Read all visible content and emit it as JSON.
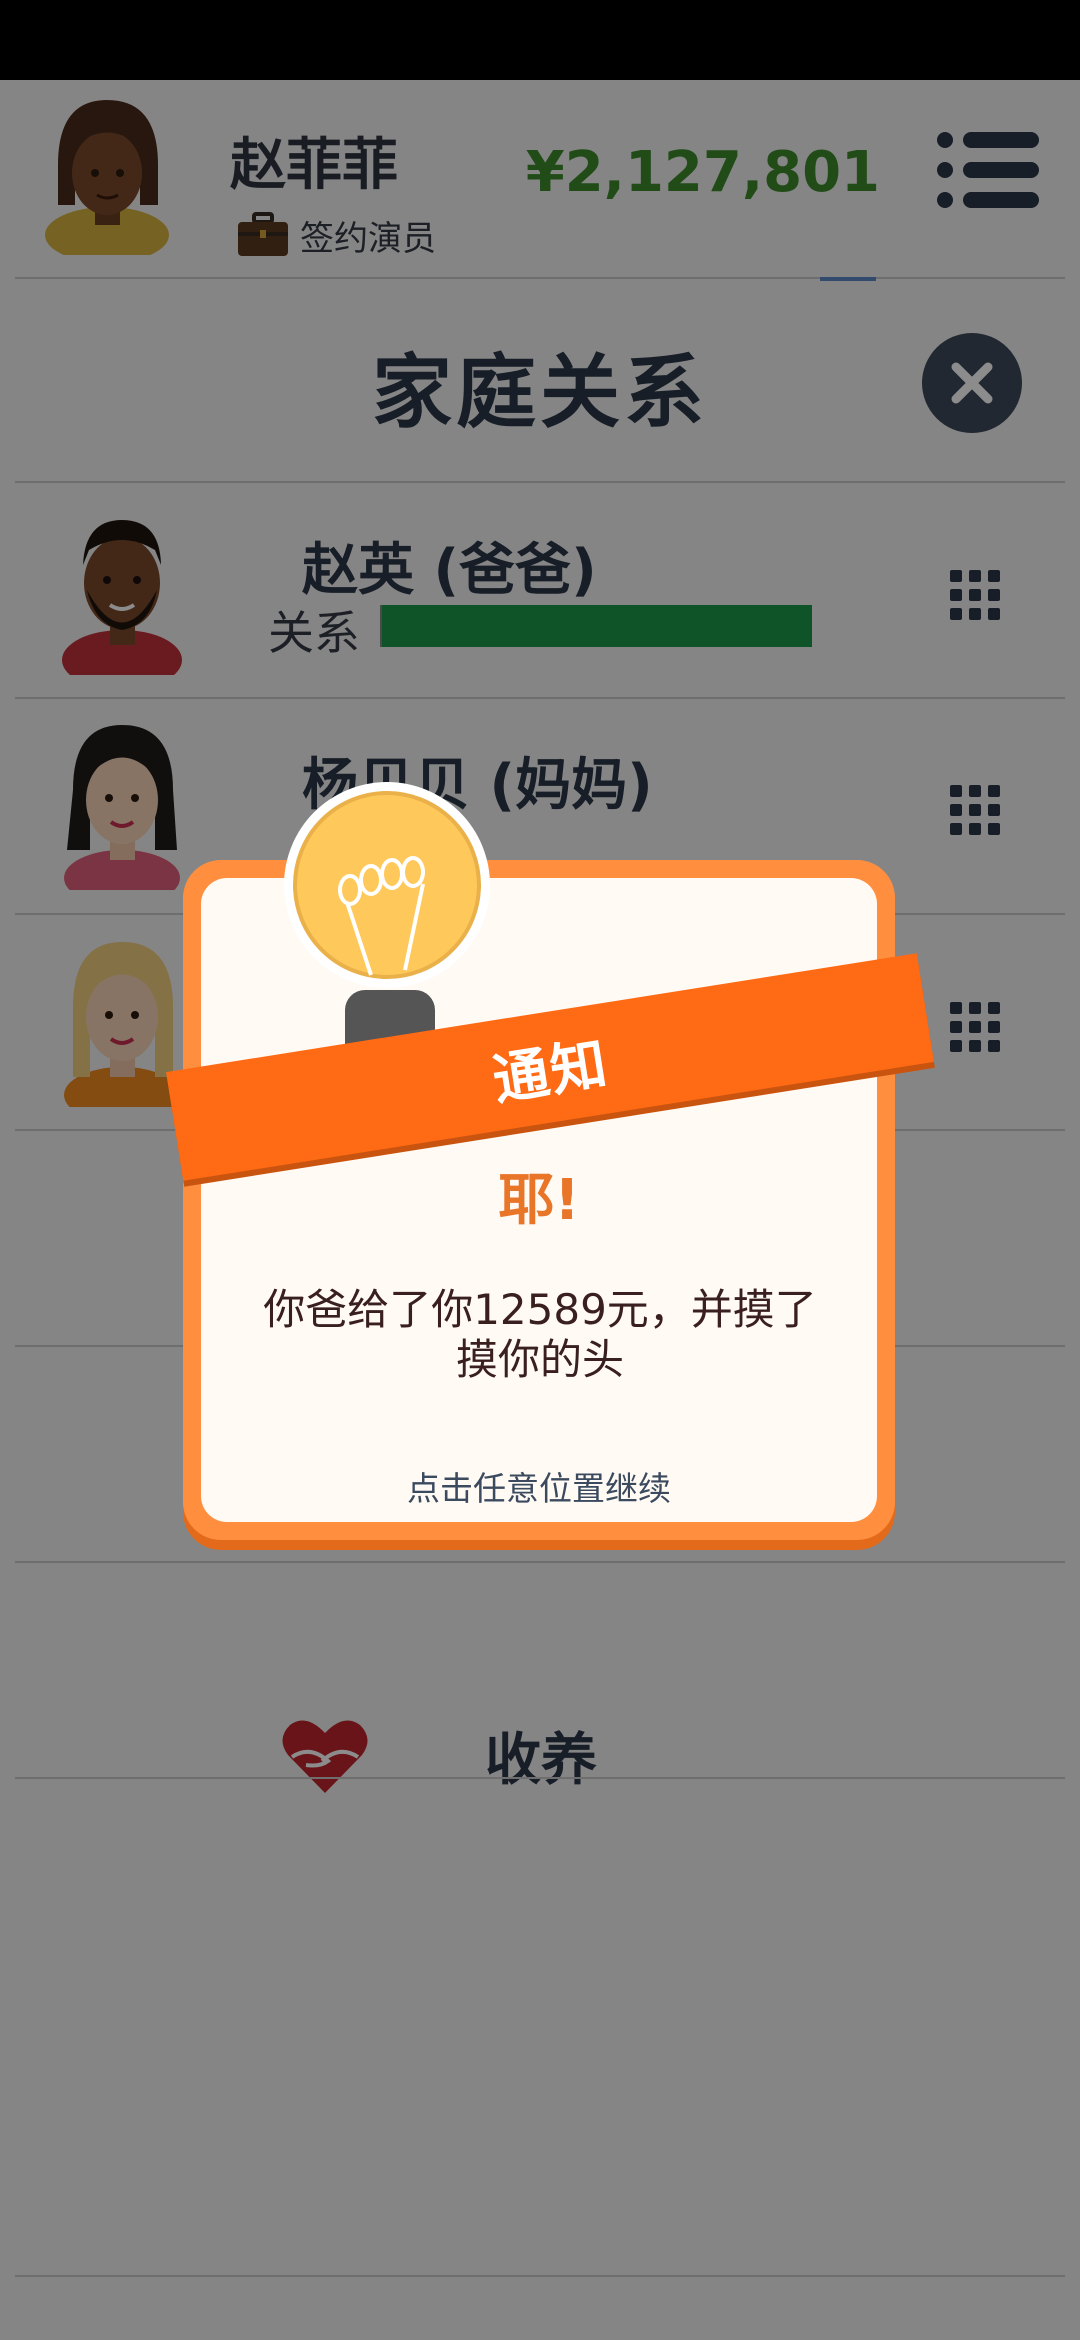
{
  "header": {
    "username": "赵菲菲",
    "job_title": "签约演员",
    "money": "¥2,127,801"
  },
  "page": {
    "title": "家庭关系"
  },
  "family": [
    {
      "name": "赵英 (爸爸)",
      "relationship_label": "关系",
      "relationship_level": 1.0
    },
    {
      "name": "杨贝贝 (妈妈)"
    },
    {
      "name": ""
    }
  ],
  "adopt": {
    "label": "收养"
  },
  "dialog": {
    "banner": "通知",
    "heading": "耶!",
    "message": "你爸给了你12589元，并摸了摸你的头",
    "hint": "点击任意位置继续"
  },
  "colors": {
    "money": "#3d8b2c",
    "relationship_bar": "#1b9a4a",
    "dialog_orange": "#ff6a14",
    "heading_orange": "#e87528"
  }
}
